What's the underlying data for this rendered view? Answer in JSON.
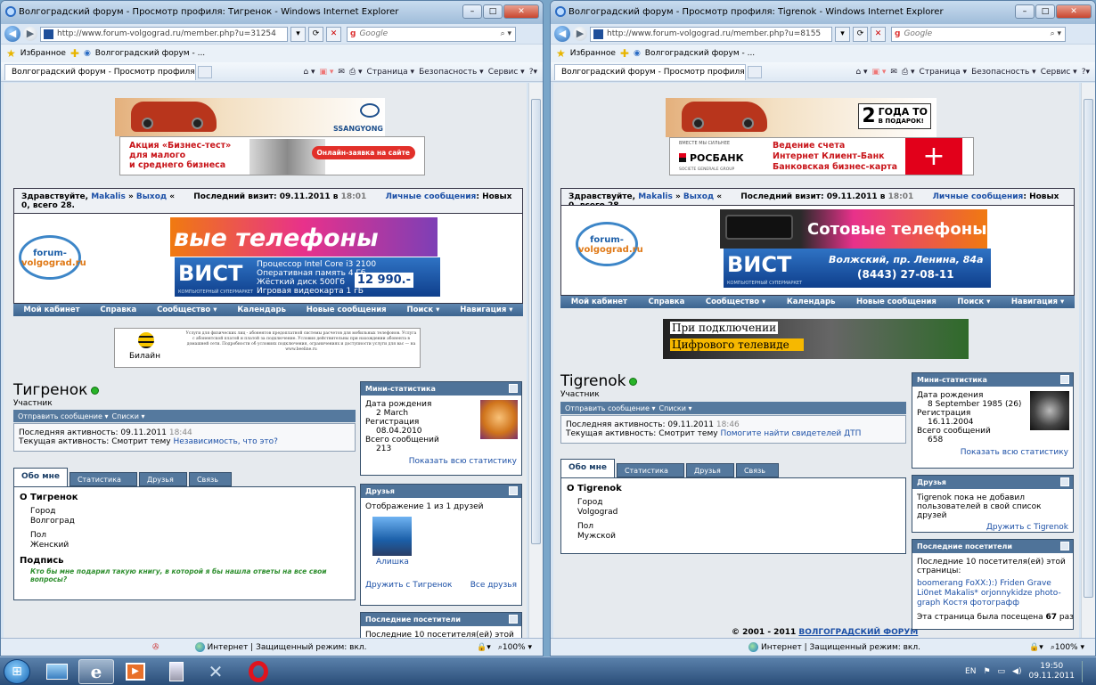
{
  "left": {
    "title": "Волгоградский форум - Просмотр профиля: Тигренок - Windows Internet Explorer",
    "url": "http://www.forum-volgograd.ru/member.php?u=31254",
    "search_placeholder": "Google",
    "favorites": "Избранное",
    "fav_item": "Волгоградский форум - ...",
    "tab_title": "Волгоградский форум - Просмотр профиля: Т...",
    "cmds": [
      "Страница ▾",
      "Безопасность ▾",
      "Сервис ▾"
    ],
    "ad1_brand": "SSANGYONG",
    "ad2_lines": [
      "Акция «Бизнес-тест»",
      "для малого",
      "и среднего бизнеса"
    ],
    "ad2_button": "Онлайн-заявка на сайте",
    "greeting": "Здравствуйте,",
    "user": "Makalis",
    "logout": "Выход",
    "last_visit": "Последний визит: 09.11.2011 в",
    "last_visit_time": "18:01",
    "pm_label": "Личные сообщения",
    "pm_value": ": Новых 0, всего 28.",
    "logo_top": "forum-",
    "logo_bottom": "volgograd.ru",
    "banner_text": "вые телефоны",
    "vist_logo": "ВИСТ",
    "vist_sub": "КОМПЬЮТЕРНЫЙ СУПЕРМАРКЕТ",
    "vist_lines": [
      "Процессор Intel Core i3 2100",
      "Оперативная память 4 Гб",
      "Жёсткий диск 500Гб",
      "Игровая видеокарта 1 гБ"
    ],
    "vist_price": "12 990.-",
    "nav": [
      "Мой кабинет",
      "Справка",
      "Сообщество ▾",
      "Календарь",
      "Новые сообщения",
      "Поиск ▾",
      "Навигация ▾"
    ],
    "ad3_brand": "Билайн",
    "ad3_text": "Услуги для физических лиц - абонентов предоплатной системы расчетов для мобильных телефонов. Услуга с абонентской платой и платой за подключение. Условия действительны при нахождении абонента в домашней сети. Подробности об условиях подключения, ограничениях и доступности услуги для вас — на www.beeline.ru",
    "profile_name": "Тигренок",
    "profile_role": "Участник",
    "send_msg": "Отправить сообщение ▾",
    "lists": "Списки ▾",
    "last_activity": "Последняя активность: 09.11.2011",
    "last_activity_time": "18:44",
    "current_activity": "Текущая активность: Смотрит тему",
    "current_topic": "Независимость, что это?",
    "tabs": [
      "Обо мне",
      "Статистика",
      "Друзья",
      "Связь"
    ],
    "about_title": "О Тигренок",
    "city_label": "Город",
    "city": "Волгоград",
    "sex_label": "Пол",
    "sex": "Женский",
    "sig_title": "Подпись",
    "signature": "Кто бы мне подарил такую книгу, в которой я бы нашла ответы на все свои вопросы?",
    "stats_title": "Мини-статистика",
    "birth_label": "Дата рождения",
    "birth": "2 March",
    "reg_label": "Регистрация",
    "reg": "08.04.2010",
    "posts_label": "Всего сообщений",
    "posts": "213",
    "stats_link": "Показать всю статистику",
    "friends_title": "Друзья",
    "friends_count": "Отображение 1 из 1 друзей",
    "friend_name": "Алишка",
    "befriend": "Дружить с Тигренок",
    "all_friends": "Все друзья",
    "visitors_title": "Последние посетители",
    "visitors_text": "Последние 10 посетителя(ей) этой",
    "status_text": "Интернет | Защищенный режим: вкл.",
    "zoom": "100%"
  },
  "right": {
    "title": "Волгоградский форум - Просмотр профиля: Tigrenok - Windows Internet Explorer",
    "url": "http://www.forum-volgograd.ru/member.php?u=8155",
    "search_placeholder": "Google",
    "favorites": "Избранное",
    "fav_item": "Волгоградский форум - ...",
    "tab_title": "Волгоградский форум - Просмотр профиля: Т...",
    "cmds": [
      "Страница ▾",
      "Безопасность ▾",
      "Сервис ▾"
    ],
    "ad1_num": "2",
    "ad1_text": [
      "ГОДА ТО",
      "В ПОДАРОК!"
    ],
    "ad2_small": "ВМЕСТЕ МЫ СИЛЬНЕЕ",
    "ad2_bank": "РОСБАНК",
    "ad2_group": "SOCIETE GENERALE GROUP",
    "ad2_lines": [
      "Ведение счета",
      "Интернет Клиент-Банк",
      "Банковская бизнес-карта"
    ],
    "greeting": "Здравствуйте,",
    "user": "Makalis",
    "logout": "Выход",
    "last_visit": "Последний визит: 09.11.2011 в",
    "last_visit_time": "18:01",
    "pm_label": "Личные сообщения",
    "pm_value": ": Новых 0, всего 28.",
    "logo_top": "forum-",
    "logo_bottom": "volgograd.ru",
    "banner_text": "Сотовые телефоны",
    "vist_logo": "ВИСТ",
    "vist_sub": "КОМПЬЮТЕРНЫЙ СУПЕРМАРКЕТ",
    "vist_addr": "Волжский, пр. Ленина, 84а",
    "vist_phone": "(8443) 27-08-11",
    "nav": [
      "Мой кабинет",
      "Справка",
      "Сообщество ▾",
      "Календарь",
      "Новые сообщения",
      "Поиск ▾",
      "Навигация ▾"
    ],
    "tv_line1": "При подключении",
    "tv_line2": "Цифрового телевиде",
    "profile_name": "Tigrenok",
    "profile_role": "Участник",
    "send_msg": "Отправить сообщение ▾",
    "lists": "Списки ▾",
    "last_activity": "Последняя активность: 09.11.2011",
    "last_activity_time": "18:46",
    "current_activity": "Текущая активность: Смотрит тему",
    "current_topic": "Помогите найти свидетелей ДТП",
    "tabs": [
      "Обо мне",
      "Статистика",
      "Друзья",
      "Связь"
    ],
    "about_title": "О Tigrenok",
    "city_label": "Город",
    "city": "Volgograd",
    "sex_label": "Пол",
    "sex": "Мужской",
    "copyright": "© 2001 - 2011",
    "copyright_link": "ВОЛГОГРАДСКИЙ ФОРУМ",
    "stats_title": "Мини-статистика",
    "birth_label": "Дата рождения",
    "birth": "8 September 1985 (26)",
    "reg_label": "Регистрация",
    "reg": "16.11.2004",
    "posts_label": "Всего сообщений",
    "posts": "658",
    "stats_link": "Показать всю статистику",
    "friends_title": "Друзья",
    "friends_text": "Tigrenok пока не добавил пользователей в свой список друзей",
    "befriend": "Дружить с Tigrenok",
    "visitors_title": "Последние посетители",
    "visitors_text": "Последние 10 посетителя(ей) этой страницы:",
    "visitors": [
      "boomerang",
      "FoXX:):)",
      "Friden",
      "Grave",
      "Li0net",
      "Makalis*",
      "orjonnykidze",
      "photo-graph",
      "Костя",
      "фотографф"
    ],
    "visits_text": "Эта страница была посещена",
    "visits": "67",
    "visits_suffix": "раз",
    "status_text": "Интернет | Защищенный режим: вкл.",
    "zoom": "100%"
  },
  "taskbar": {
    "lang": "EN",
    "time": "19:50",
    "date": "09.11.2011"
  }
}
